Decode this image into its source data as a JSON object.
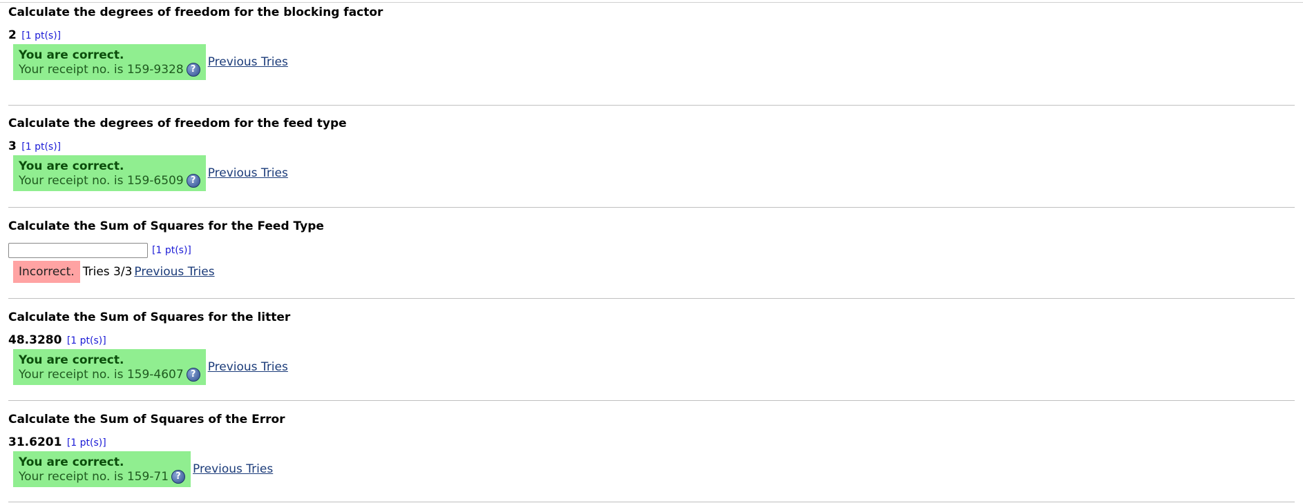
{
  "problems": [
    {
      "question": "Calculate the degrees of freedom for the blocking factor",
      "answer": "2",
      "points": "[1 pt(s)]",
      "status_title": "You are correct.",
      "receipt": "Your receipt no. is 159-9328",
      "previous_tries": "Previous Tries"
    },
    {
      "question": "Calculate the degrees of freedom for the feed type",
      "answer": "3",
      "points": "[1 pt(s)]",
      "status_title": "You are correct.",
      "receipt": "Your receipt no. is 159-6509",
      "previous_tries": "Previous Tries"
    },
    {
      "question": "Calculate the Sum of Squares for the Feed Type",
      "input_value": "",
      "points": "[1 pt(s)]",
      "status_title": "Incorrect.",
      "tries": "Tries 3/3",
      "previous_tries": "Previous Tries"
    },
    {
      "question": "Calculate the Sum of Squares for the litter",
      "answer": "48.3280",
      "points": "[1 pt(s)]",
      "status_title": "You are correct.",
      "receipt": "Your receipt no. is 159-4607",
      "previous_tries": "Previous Tries"
    },
    {
      "question": "Calculate the Sum of Squares of the Error",
      "answer": "31.6201",
      "points": "[1 pt(s)]",
      "status_title": "You are correct.",
      "receipt": "Your receipt no. is 159-71",
      "previous_tries": "Previous Tries"
    }
  ],
  "colors": {
    "correct_bg": "#90ee90",
    "incorrect_bg": "#ffa3a3",
    "link": "#1b3b79",
    "points": "#1a1ad6"
  }
}
